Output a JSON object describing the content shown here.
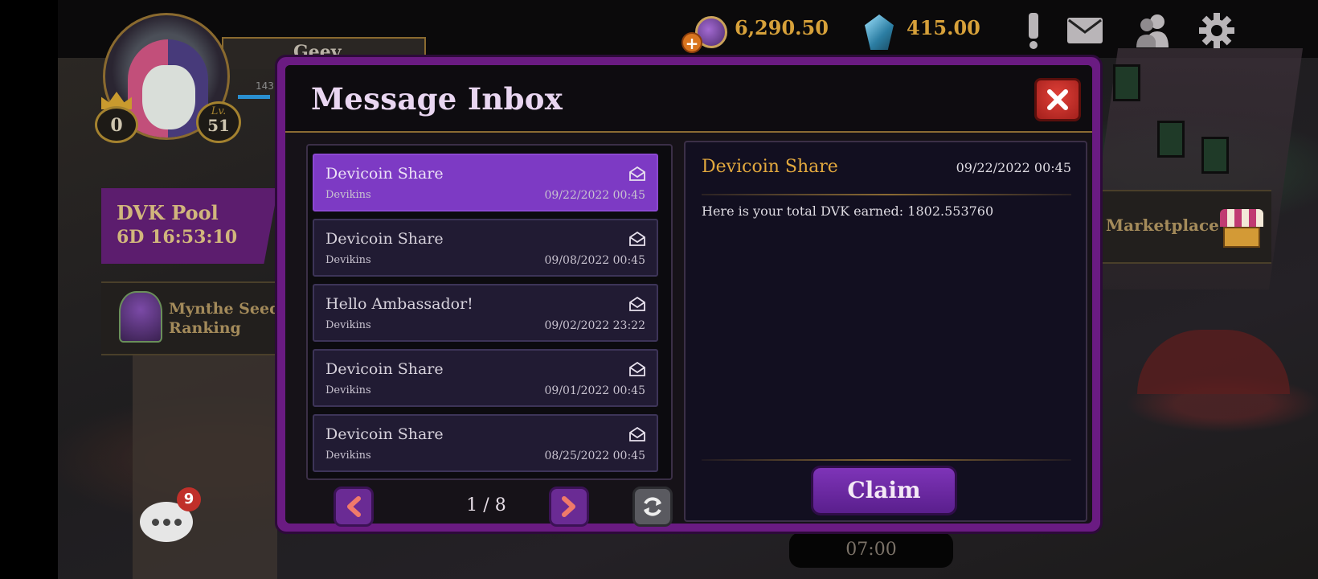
{
  "hud": {
    "coins": "6,290.50",
    "gems": "415.00",
    "icons": [
      "coin-icon",
      "gem-icon",
      "alert-icon",
      "mail-icon",
      "friends-icon",
      "gear-icon"
    ]
  },
  "profile": {
    "name": "Geev",
    "xp_text": "143",
    "rank": "0",
    "level_label": "Lv.",
    "level": "51"
  },
  "side": {
    "dvk_pool_title": "DVK Pool",
    "dvk_pool_timer": "6D 16:53:10",
    "seed_ranking": "Mynthe Seed Ranking",
    "marketplace": "Marketplace"
  },
  "chat": {
    "unread": "9"
  },
  "clock": "07:00",
  "modal": {
    "title": "Message Inbox",
    "messages": [
      {
        "title": "Devicoin Share",
        "sender": "Devikins",
        "date": "09/22/2022 00:45",
        "selected": true
      },
      {
        "title": "Devicoin Share",
        "sender": "Devikins",
        "date": "09/08/2022 00:45",
        "selected": false
      },
      {
        "title": "Hello Ambassador!",
        "sender": "Devikins",
        "date": "09/02/2022 23:22",
        "selected": false
      },
      {
        "title": "Devicoin Share",
        "sender": "Devikins",
        "date": "09/01/2022 00:45",
        "selected": false
      },
      {
        "title": "Devicoin Share",
        "sender": "Devikins",
        "date": "08/25/2022 00:45",
        "selected": false
      }
    ],
    "pagination": "1 / 8",
    "detail": {
      "title": "Devicoin Share",
      "date": "09/22/2022 00:45",
      "body": "Here is your total DVK earned: 1802.553760",
      "claim_label": "Claim"
    }
  },
  "colors": {
    "accent_purple": "#7d3ac4",
    "modal_border": "#6a1b82",
    "gold_text": "#e3a93e",
    "close_red": "#d23a33"
  }
}
